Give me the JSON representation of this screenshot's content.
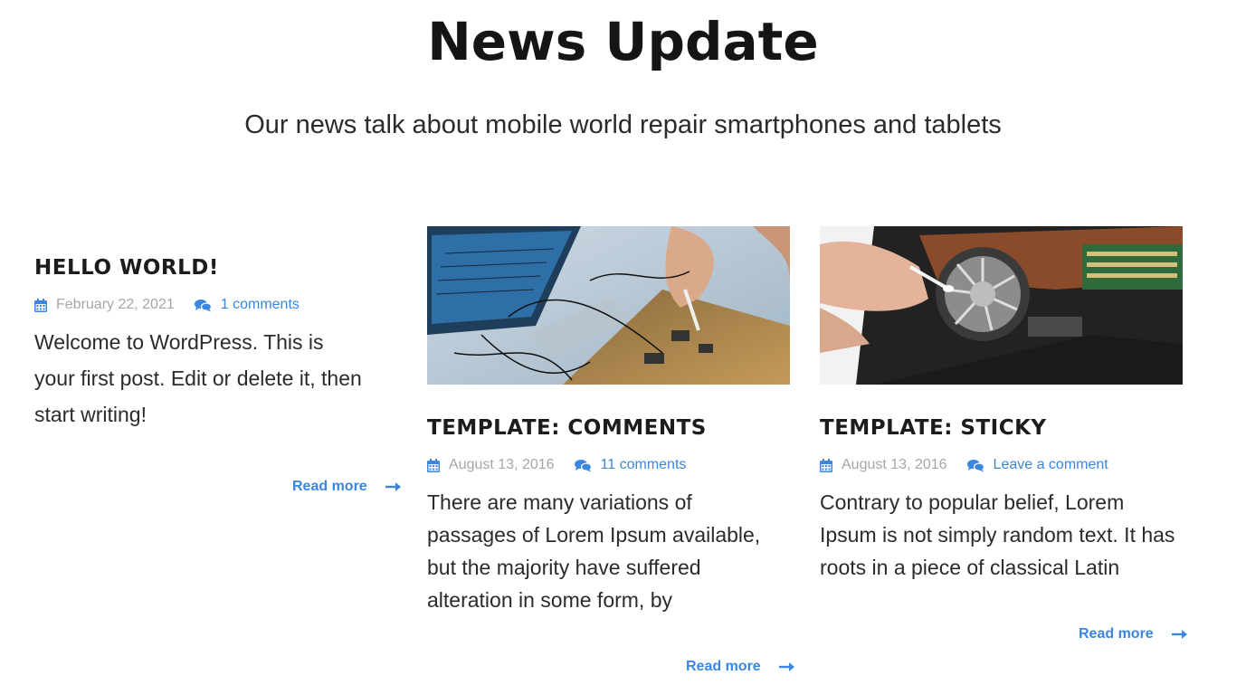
{
  "header": {
    "title": "News Update",
    "subtitle": "Our news talk about mobile world repair smartphones and tablets"
  },
  "colors": {
    "accent": "#3a86e0",
    "muted": "#a6a6a6",
    "heading": "#1c1c1c"
  },
  "posts": [
    {
      "title": "HELLO WORLD!",
      "date": "February 22, 2021",
      "comments": "1 comments",
      "excerpt": "Welcome to WordPress. This is your first post. Edit or delete it, then start writing!",
      "read_more": "Read more"
    },
    {
      "title": "TEMPLATE: COMMENTS",
      "date": "August 13, 2016",
      "comments": "11 comments",
      "excerpt": "There are many variations of passages of Lorem Ipsum available, but the majority have suffered alteration in some form, by",
      "read_more": "Read more",
      "image_icon": "electronics-repair-photo"
    },
    {
      "title": "TEMPLATE: STICKY",
      "date": "August 13, 2016",
      "comments": "Leave a comment",
      "excerpt": "Contrary to popular belief, Lorem Ipsum is not simply random text. It has roots in a piece of classical Latin",
      "read_more": "Read more",
      "image_icon": "laptop-fan-cleaning-photo"
    }
  ]
}
